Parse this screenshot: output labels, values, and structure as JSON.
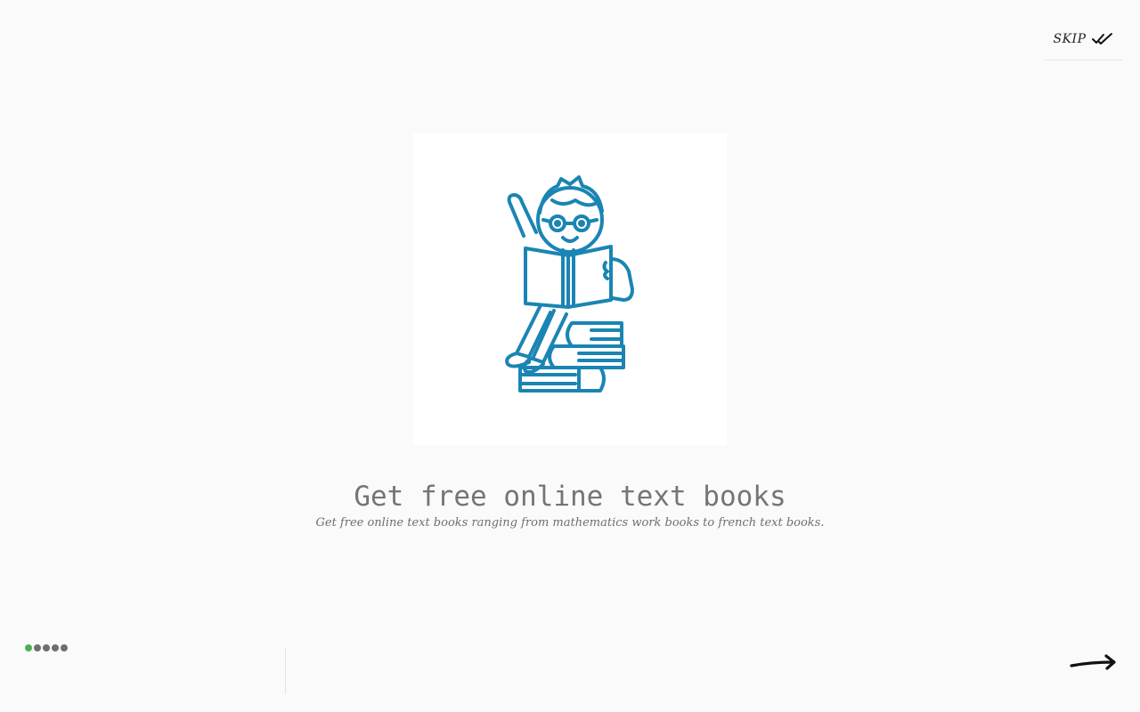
{
  "skip": {
    "label": "SKIP",
    "icon": "double-check-icon"
  },
  "slide": {
    "illustration": "child-reading-books-illustration",
    "title": "Get free online text books",
    "subtitle": "Get free online text books ranging from mathematics work books to french text books."
  },
  "pagination": {
    "total": 5,
    "current": 1,
    "active_color": "#4caf50",
    "inactive_color": "#6e6e6e"
  },
  "next": {
    "icon": "arrow-right-icon"
  },
  "colors": {
    "illustration_stroke": "#1a85b3",
    "background": "#fafafa"
  }
}
